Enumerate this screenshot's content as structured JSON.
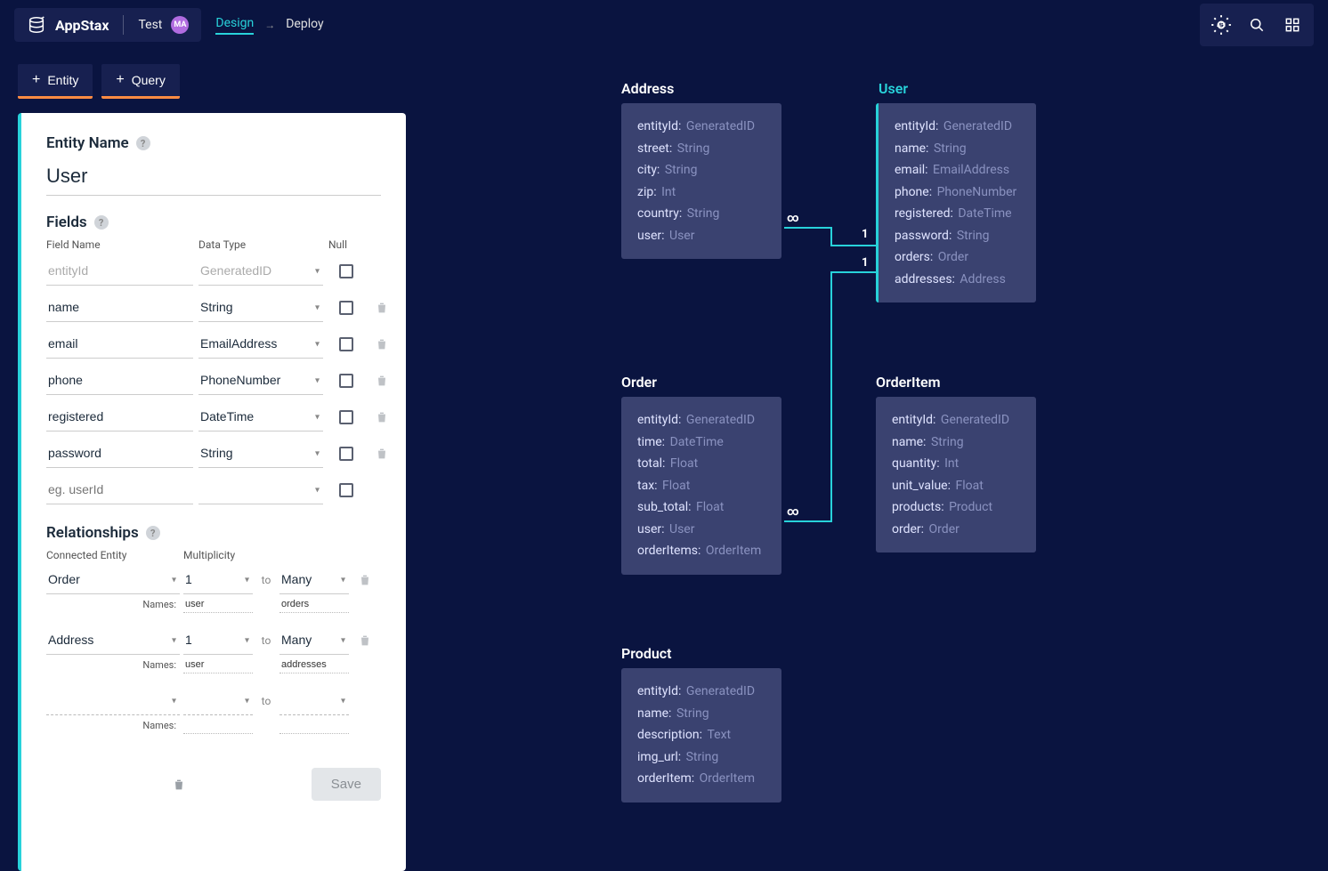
{
  "brand": "AppStax",
  "project": "Test",
  "avatar_initials": "MA",
  "nav": {
    "design": "Design",
    "deploy": "Deploy"
  },
  "actions": {
    "entity": "Entity",
    "query": "Query"
  },
  "editor": {
    "entity_name_label": "Entity Name",
    "entity_name_value": "User",
    "fields_label": "Fields",
    "headers": {
      "name": "Field Name",
      "type": "Data Type",
      "null": "Null"
    },
    "placeholder_field": "eg. userId",
    "rows": [
      {
        "name": "entityId",
        "type": "GeneratedID",
        "muted": true,
        "deletable": false
      },
      {
        "name": "name",
        "type": "String",
        "muted": false,
        "deletable": true
      },
      {
        "name": "email",
        "type": "EmailAddress",
        "muted": false,
        "deletable": true
      },
      {
        "name": "phone",
        "type": "PhoneNumber",
        "muted": false,
        "deletable": true
      },
      {
        "name": "registered",
        "type": "DateTime",
        "muted": false,
        "deletable": true
      },
      {
        "name": "password",
        "type": "String",
        "muted": false,
        "deletable": true
      }
    ],
    "relationships_label": "Relationships",
    "rel_headers": {
      "entity": "Connected Entity",
      "mult": "Multiplicity"
    },
    "to_label": "to",
    "names_label": "Names:",
    "relationships": [
      {
        "entity": "Order",
        "left_mult": "1",
        "right_mult": "Many",
        "left_name": "user",
        "right_name": "orders"
      },
      {
        "entity": "Address",
        "left_mult": "1",
        "right_mult": "Many",
        "left_name": "user",
        "right_name": "addresses"
      },
      {
        "entity": "",
        "left_mult": "",
        "right_mult": "",
        "left_name": "",
        "right_name": ""
      }
    ],
    "save_label": "Save"
  },
  "canvas": {
    "entities": {
      "address": {
        "title": "Address",
        "fields": [
          {
            "k": "entityId:",
            "t": "GeneratedID"
          },
          {
            "k": "street:",
            "t": "String"
          },
          {
            "k": "city:",
            "t": "String"
          },
          {
            "k": "zip:",
            "t": "Int"
          },
          {
            "k": "country:",
            "t": "String"
          },
          {
            "k": "user:",
            "t": "User"
          }
        ]
      },
      "user": {
        "title": "User",
        "fields": [
          {
            "k": "entityId:",
            "t": "GeneratedID"
          },
          {
            "k": "name:",
            "t": "String"
          },
          {
            "k": "email:",
            "t": "EmailAddress"
          },
          {
            "k": "phone:",
            "t": "PhoneNumber"
          },
          {
            "k": "registered:",
            "t": "DateTime"
          },
          {
            "k": "password:",
            "t": "String"
          },
          {
            "k": "orders:",
            "t": "Order"
          },
          {
            "k": "addresses:",
            "t": "Address"
          }
        ]
      },
      "order": {
        "title": "Order",
        "fields": [
          {
            "k": "entityId:",
            "t": "GeneratedID"
          },
          {
            "k": "time:",
            "t": "DateTime"
          },
          {
            "k": "total:",
            "t": "Float"
          },
          {
            "k": "tax:",
            "t": "Float"
          },
          {
            "k": "sub_total:",
            "t": "Float"
          },
          {
            "k": "user:",
            "t": "User"
          },
          {
            "k": "orderItems:",
            "t": "OrderItem"
          }
        ]
      },
      "orderitem": {
        "title": "OrderItem",
        "fields": [
          {
            "k": "entityId:",
            "t": "GeneratedID"
          },
          {
            "k": "name:",
            "t": "String"
          },
          {
            "k": "quantity:",
            "t": "Int"
          },
          {
            "k": "unit_value:",
            "t": "Float"
          },
          {
            "k": "products:",
            "t": "Product"
          },
          {
            "k": "order:",
            "t": "Order"
          }
        ]
      },
      "product": {
        "title": "Product",
        "fields": [
          {
            "k": "entityId:",
            "t": "GeneratedID"
          },
          {
            "k": "name:",
            "t": "String"
          },
          {
            "k": "description:",
            "t": "Text"
          },
          {
            "k": "img_url:",
            "t": "String"
          },
          {
            "k": "orderItem:",
            "t": "OrderItem"
          }
        ]
      }
    },
    "cardinality": {
      "inf": "∞",
      "one": "1"
    }
  }
}
